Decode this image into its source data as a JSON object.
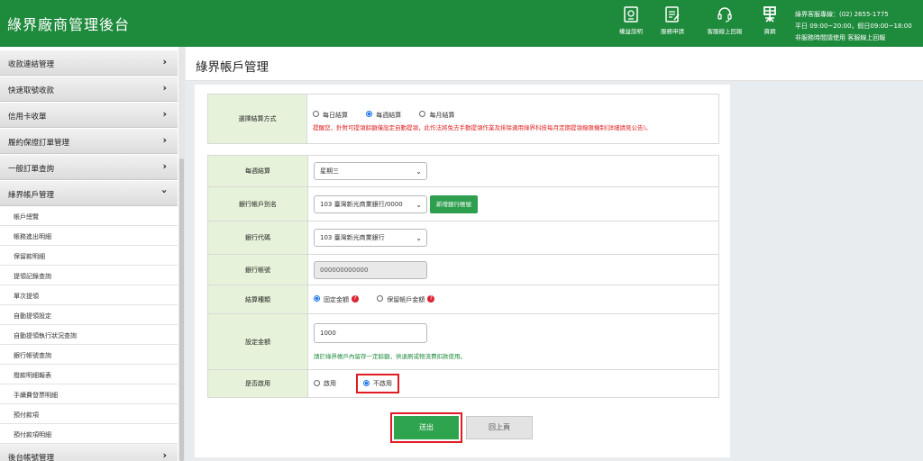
{
  "header": {
    "brand": "綠界廠商管理後台",
    "tools": [
      {
        "label": "權益說明",
        "icon": "rights-doc-icon"
      },
      {
        "label": "服務申請",
        "icon": "apply-form-icon"
      },
      {
        "label": "客服線上回報",
        "icon": "headset-icon"
      },
      {
        "label": "資網",
        "icon": "ecpay-logo-icon"
      }
    ],
    "contact": {
      "phone_line": "綠界客服專線：(02) 2655-1775",
      "hours_line": "平日 09:00~20:00，假日09:00~18:00",
      "offhours_line": "非服務時間請使用 客服線上回報"
    }
  },
  "sidebar": {
    "menus": [
      {
        "label": "收款連結管理"
      },
      {
        "label": "快速取號收款"
      },
      {
        "label": "信用卡收單"
      },
      {
        "label": "履約保證訂單管理"
      },
      {
        "label": "一般訂單查詢"
      },
      {
        "label": "綠界帳戶管理"
      }
    ],
    "submenu": [
      "帳戶總覽",
      "帳務進出明細",
      "保留款明細",
      "提領記錄查詢",
      "單次提領",
      "自動提領設定",
      "自動提領執行狀況查詢",
      "銀行帳號查詢",
      "撥款明細報表",
      "手續費發票明細",
      "預付款項",
      "預付款項明細"
    ],
    "bottom_menu": "後台帳號管理"
  },
  "page": {
    "title": "綠界帳戶管理"
  },
  "form": {
    "settle_method": {
      "label": "選擇結算方式",
      "options": [
        "每日結算",
        "每週結算",
        "每月結算"
      ],
      "selected": "每週結算",
      "warning": "提醒您，針對可提領餘額僅設定自動提領，此作法將免去手動提領作業及排除適用綠界科技每月定期提領撥匯機制(詳細請見公告)。"
    },
    "weekly": {
      "label": "每週結算",
      "value": "星期三"
    },
    "bank_alias": {
      "label": "銀行帳戶別名",
      "value": "103 臺灣新光商業銀行/0000",
      "add_button": "新增銀行帳號"
    },
    "bank_code": {
      "label": "銀行代碼",
      "value": "103 臺灣新光商業銀行"
    },
    "bank_account": {
      "label": "銀行帳號",
      "value": "000000000000"
    },
    "settle_type": {
      "label": "結算種類",
      "options": [
        "固定金額",
        "保留帳戶金額"
      ],
      "selected": "固定金額"
    },
    "amount": {
      "label": "設定金額",
      "value": "1000",
      "note": "請於綠界帳戶內留存一定餘額，供退刷或物流費扣款使用。"
    },
    "enabled": {
      "label": "是否啟用",
      "options": [
        "啟用",
        "不啟用"
      ],
      "selected": "不啟用"
    }
  },
  "buttons": {
    "submit": "送出",
    "back": "回上頁"
  },
  "colors": {
    "brand_green": "#1e8a3c",
    "label_bg": "#e6f2d9",
    "highlight_red": "#e01b24",
    "warning_red": "#e02020"
  }
}
